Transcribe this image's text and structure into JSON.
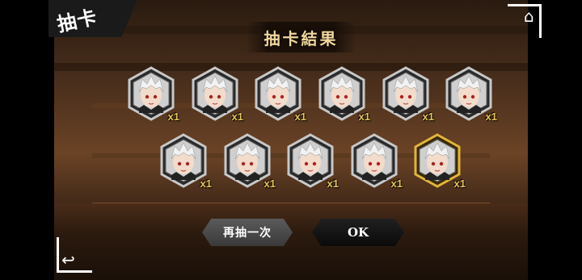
{
  "mode_tab": {
    "label": "抽卡"
  },
  "title": "抽卡結果",
  "cards": [
    {
      "qty": "x1",
      "rarity": "normal"
    },
    {
      "qty": "x1",
      "rarity": "normal"
    },
    {
      "qty": "x1",
      "rarity": "normal"
    },
    {
      "qty": "x1",
      "rarity": "normal"
    },
    {
      "qty": "x1",
      "rarity": "normal"
    },
    {
      "qty": "x1",
      "rarity": "normal"
    },
    {
      "qty": "x1",
      "rarity": "normal"
    },
    {
      "qty": "x1",
      "rarity": "normal"
    },
    {
      "qty": "x1",
      "rarity": "normal"
    },
    {
      "qty": "x1",
      "rarity": "normal"
    },
    {
      "qty": "x1",
      "rarity": "gold"
    }
  ],
  "buttons": {
    "redraw": "再抽一次",
    "ok": "OK"
  },
  "icons": {
    "home": "home-icon",
    "back": "back-icon"
  },
  "colors": {
    "title_gold": "#f0d79c",
    "qty_gold": "#e6c55a",
    "frame_silver": "#c8c8c8",
    "frame_gold": "#e2b53a"
  }
}
